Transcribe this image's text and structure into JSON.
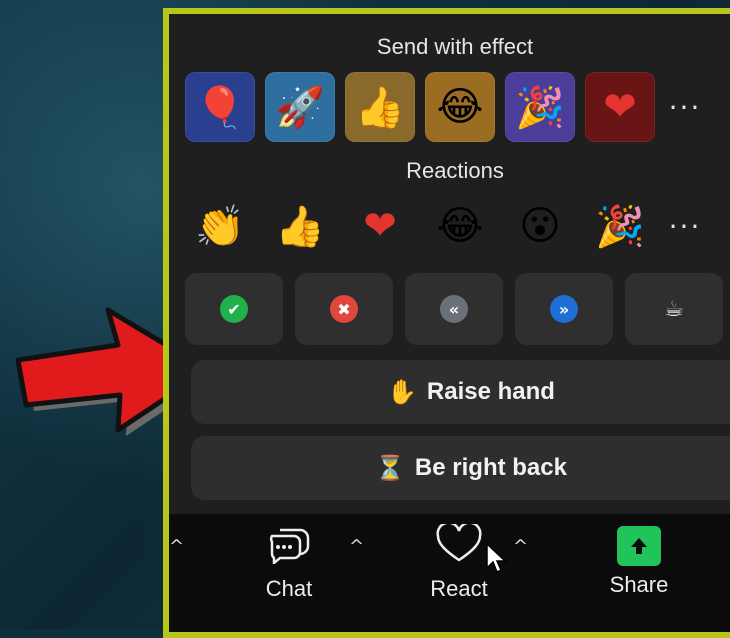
{
  "effects": {
    "title": "Send with effect",
    "tiles": [
      {
        "icon": "balloon",
        "glyph": "🎈",
        "bg": "#2a3f8f"
      },
      {
        "icon": "rocket",
        "glyph": "🚀",
        "bg": "#2f6fa0"
      },
      {
        "icon": "thumbs-up",
        "glyph": "👍",
        "bg": "#8a6a2a"
      },
      {
        "icon": "tears-of-joy",
        "glyph": "😂",
        "bg": "#9a6d23"
      },
      {
        "icon": "party-popper",
        "glyph": "🎉",
        "bg": "#4a3e9a"
      },
      {
        "icon": "heart",
        "glyph": "❤",
        "bg": "#6a1515"
      }
    ],
    "more": "···"
  },
  "reactions": {
    "title": "Reactions",
    "items": [
      {
        "icon": "clapping-hands",
        "glyph": "👏"
      },
      {
        "icon": "thumbs-up",
        "glyph": "👍"
      },
      {
        "icon": "heart",
        "glyph": "❤"
      },
      {
        "icon": "tears-of-joy",
        "glyph": "😂"
      },
      {
        "icon": "surprised-face",
        "glyph": "😮"
      },
      {
        "icon": "party-popper",
        "glyph": "🎉"
      }
    ],
    "more": "···"
  },
  "quick": [
    {
      "icon": "check-icon",
      "glyph": "✔",
      "color": "#21b04b"
    },
    {
      "icon": "cross-icon",
      "glyph": "✖",
      "color": "#e0463c"
    },
    {
      "icon": "rewind-icon",
      "glyph": "«",
      "color": "#6a6f7a"
    },
    {
      "icon": "fast-forward-icon",
      "glyph": "»",
      "color": "#1f6ed6"
    },
    {
      "icon": "coffee-icon",
      "glyph": "☕",
      "color": "#2f2f2f"
    }
  ],
  "buttons": {
    "raise_hand": {
      "icon": "✋",
      "label": "Raise hand"
    },
    "be_right_back": {
      "icon": "⏳",
      "label": "Be right back"
    }
  },
  "toolbar": {
    "chat": "Chat",
    "react": "React",
    "share": "Share",
    "caret": "^"
  },
  "colors": {
    "panel_border": "#b6c61a",
    "share_green": "#21c35b",
    "arrow_red": "#e11b1b"
  }
}
